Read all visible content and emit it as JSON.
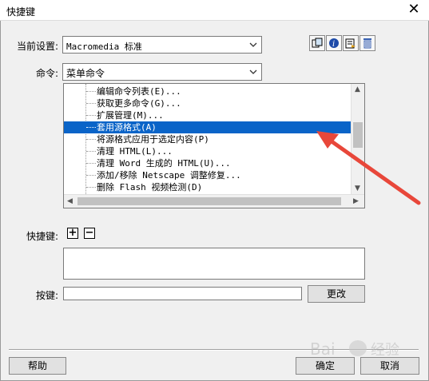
{
  "window": {
    "title": "快捷键",
    "close": "✕"
  },
  "preset": {
    "label": "当前设置:",
    "value": "Macromedia 标准"
  },
  "command": {
    "label": "命令:",
    "value": "菜单命令"
  },
  "toolbar": {
    "icons": [
      "duplicate-set-icon",
      "rename-set-icon",
      "export-set-icon",
      "delete-set-icon"
    ]
  },
  "tree": {
    "items": [
      {
        "label": "编辑命令列表(E)...",
        "selected": false
      },
      {
        "label": "获取更多命令(G)...",
        "selected": false
      },
      {
        "label": "扩展管理(M)...",
        "selected": false
      },
      {
        "label": "套用源格式(A)",
        "selected": true
      },
      {
        "label": "将源格式应用于选定内容(P)",
        "selected": false
      },
      {
        "label": "清理 HTML(L)...",
        "selected": false
      },
      {
        "label": "清理 Word 生成的 HTML(U)...",
        "selected": false
      },
      {
        "label": "添加/移除 Netscape 调整修复...",
        "selected": false
      },
      {
        "label": "删除 Flash 视频检测(D)",
        "selected": false
      }
    ]
  },
  "shortcuts": {
    "label": "快捷键:",
    "add": "+",
    "remove": "−"
  },
  "key": {
    "label": "按键:",
    "value": "",
    "change_label": "更改"
  },
  "footer": {
    "help_label": "帮助",
    "ok_label": "确定",
    "cancel_label": "取消"
  },
  "colors": {
    "selection": "#0a64c8",
    "annotation_arrow": "#e8473a"
  }
}
